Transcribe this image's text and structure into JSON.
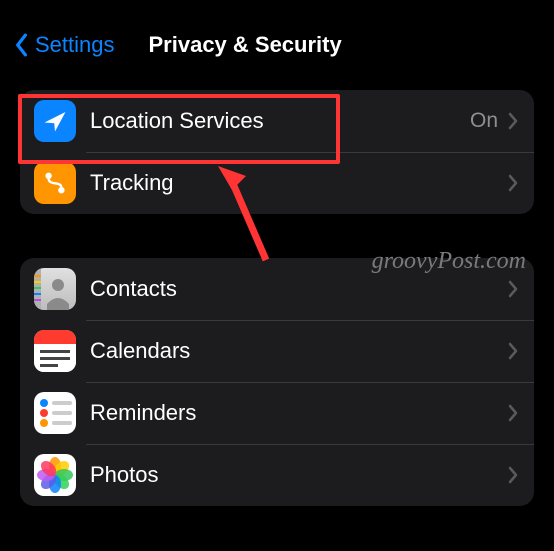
{
  "header": {
    "back_label": "Settings",
    "title": "Privacy & Security"
  },
  "groups": [
    {
      "rows": [
        {
          "icon": "location-arrow-icon",
          "label": "Location Services",
          "detail": "On"
        },
        {
          "icon": "tracking-icon",
          "label": "Tracking",
          "detail": ""
        }
      ]
    },
    {
      "rows": [
        {
          "icon": "contacts-icon",
          "label": "Contacts",
          "detail": ""
        },
        {
          "icon": "calendar-icon",
          "label": "Calendars",
          "detail": ""
        },
        {
          "icon": "reminders-icon",
          "label": "Reminders",
          "detail": ""
        },
        {
          "icon": "photos-icon",
          "label": "Photos",
          "detail": ""
        }
      ]
    }
  ],
  "watermark": "groovyPost.com",
  "annotation": {
    "highlight_target": "Location Services",
    "arrow_color": "#ff3535"
  }
}
